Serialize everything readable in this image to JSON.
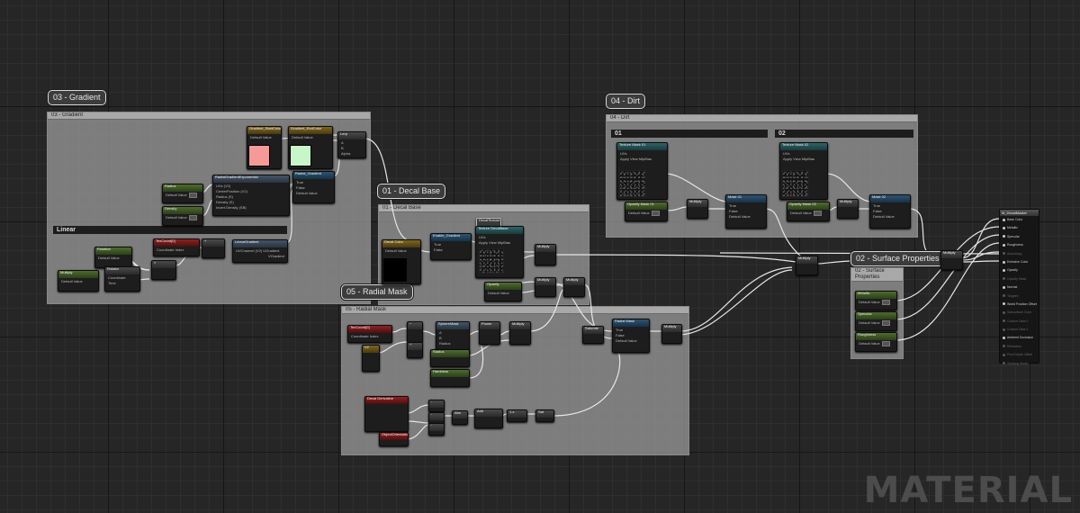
{
  "comments": {
    "gradient": {
      "bubble": "03 - Gradient",
      "header": "03 - Gradient"
    },
    "decal": {
      "bubble": "01 - Decal Base",
      "header": "01 - Decal Base"
    },
    "dirt": {
      "bubble": "04 - Dirt",
      "header": "04 - Dirt"
    },
    "radial": {
      "bubble": "05 - Radial Mask",
      "header": "05 - Radial Mask"
    },
    "surface": {
      "bubble": "02 - Surface Properties",
      "header": "02 - Surface Properties"
    }
  },
  "sections": {
    "linear": "Linear",
    "dirt_01": "01",
    "dirt_02": "02"
  },
  "colors": {
    "swatch_red": "#f59a96",
    "swatch_green": "#c7f6c8",
    "wire": "#e6e6e6"
  },
  "nodes": {
    "gradient_start_color": {
      "title": "Gradient_StartColor",
      "sub": "Param (1,0,0)",
      "rows": [
        "Default Value"
      ]
    },
    "gradient_end_color": {
      "title": "Gradient_EndColor",
      "sub": "Param (1,0,0)",
      "rows": [
        "Default Value"
      ]
    },
    "lerp_gradient": {
      "title": "Lerp",
      "rows": [
        "A",
        "B",
        "Alpha"
      ]
    },
    "radial_falloff": {
      "title": "RadialGradientExponential",
      "rows": [
        "UVs (V2)",
        "CenterPosition (V2)",
        "Radius (S)",
        "Density (S)",
        "Invert Density (SB)"
      ],
      "output": "RadialGradientExponential"
    },
    "radius_param": {
      "title": "Radius",
      "rows": [
        "Default Value"
      ]
    },
    "density_param": {
      "title": "Density",
      "rows": [
        "Default Value"
      ]
    },
    "switch_gradient": {
      "title": "Radial_Gradient",
      "rows": [
        "True",
        "False",
        "Default Value"
      ]
    },
    "rotation_param": {
      "title": "Rotation",
      "rows": [
        "Default Value"
      ]
    },
    "rotator": {
      "title": "Rotator",
      "rows": [
        "Coordinate",
        "Time"
      ]
    },
    "tex_coord_gradient": {
      "title": "TexCoord[0]",
      "rows": [
        "Coordinate Index"
      ]
    },
    "linear_gradient": {
      "title": "LinearGradient",
      "rows": [
        "UVChannel (V2)"
      ],
      "outputs": [
        "UGradient",
        "VGradient"
      ]
    },
    "decal_color": {
      "title": "Decal Color",
      "rows": [
        "Default Value"
      ]
    },
    "enable_gradient": {
      "title": "Enable_Gradient",
      "rows": [
        "True",
        "False"
      ]
    },
    "texture_decal_base": {
      "title": "Texture DecalBase",
      "rows": [
        "UVs",
        "Apply View MipBias"
      ],
      "outputs": [
        "RGB",
        "R",
        "G",
        "B",
        "A",
        "RGBA"
      ]
    },
    "decal_texture_param": {
      "title": "DecalTexture"
    },
    "texture_mask_01": {
      "title": "Texture Mask 01",
      "rows": [
        "UVs",
        "Apply View MipBias"
      ]
    },
    "texture_mask_02": {
      "title": "Texture Mask 02",
      "rows": [
        "UVs",
        "Apply View MipBias"
      ]
    },
    "opacity_mask_01": {
      "title": "Opacity Mask 01",
      "rows": [
        "Default Value"
      ]
    },
    "opacity_mask_02": {
      "title": "Opacity Mask 02",
      "rows": [
        "Default Value"
      ]
    },
    "mask_01_switch": {
      "title": "Mask 01",
      "rows": [
        "True",
        "False",
        "Default Value"
      ]
    },
    "mask_02_switch": {
      "title": "Mask 02",
      "rows": [
        "True",
        "False",
        "Default Value"
      ]
    },
    "metallic_param": {
      "title": "Metallic",
      "rows": [
        "Default Value"
      ]
    },
    "specular_param": {
      "title": "Specular",
      "rows": [
        "Default Value"
      ]
    },
    "roughness_param": {
      "title": "Roughness",
      "rows": [
        "Default Value"
      ]
    },
    "tex_coord_radial": {
      "title": "TexCoord[0]",
      "rows": [
        "Coordinate Index"
      ]
    },
    "sphere_mask": {
      "title": "SphereMask",
      "rows": [
        "A",
        "B",
        "Radius",
        "Hardness"
      ]
    },
    "radial_mask_switch": {
      "title": "Radial Mask",
      "sub": "Switch Param (False)",
      "rows": [
        "True",
        "False",
        "Default Value"
      ]
    },
    "decal_derivative": {
      "title": "Decal Derivative",
      "rows": []
    },
    "object_orientation": {
      "title": "ObjectOrientation",
      "rows": []
    },
    "saturate": {
      "title": "Saturate"
    }
  },
  "result_node": {
    "title": "M_DecalMaster",
    "pins": [
      {
        "label": "Base Color",
        "active": true
      },
      {
        "label": "Metallic",
        "active": true
      },
      {
        "label": "Specular",
        "active": true
      },
      {
        "label": "Roughness",
        "active": true
      },
      {
        "label": "Anisotropy",
        "active": false
      },
      {
        "label": "Emissive Color",
        "active": true
      },
      {
        "label": "Opacity",
        "active": true
      },
      {
        "label": "Opacity Mask",
        "active": false
      },
      {
        "label": "Normal",
        "active": true
      },
      {
        "label": "Tangent",
        "active": false
      },
      {
        "label": "World Position Offset",
        "active": true
      },
      {
        "label": "Subsurface Color",
        "active": false
      },
      {
        "label": "Custom Data 0",
        "active": false
      },
      {
        "label": "Custom Data 1",
        "active": false
      },
      {
        "label": "Ambient Occlusion",
        "active": true
      },
      {
        "label": "Refraction",
        "active": false
      },
      {
        "label": "Pixel Depth Offset",
        "active": false
      },
      {
        "label": "Shading Model",
        "active": false
      }
    ]
  },
  "watermark": "MATERIAL"
}
